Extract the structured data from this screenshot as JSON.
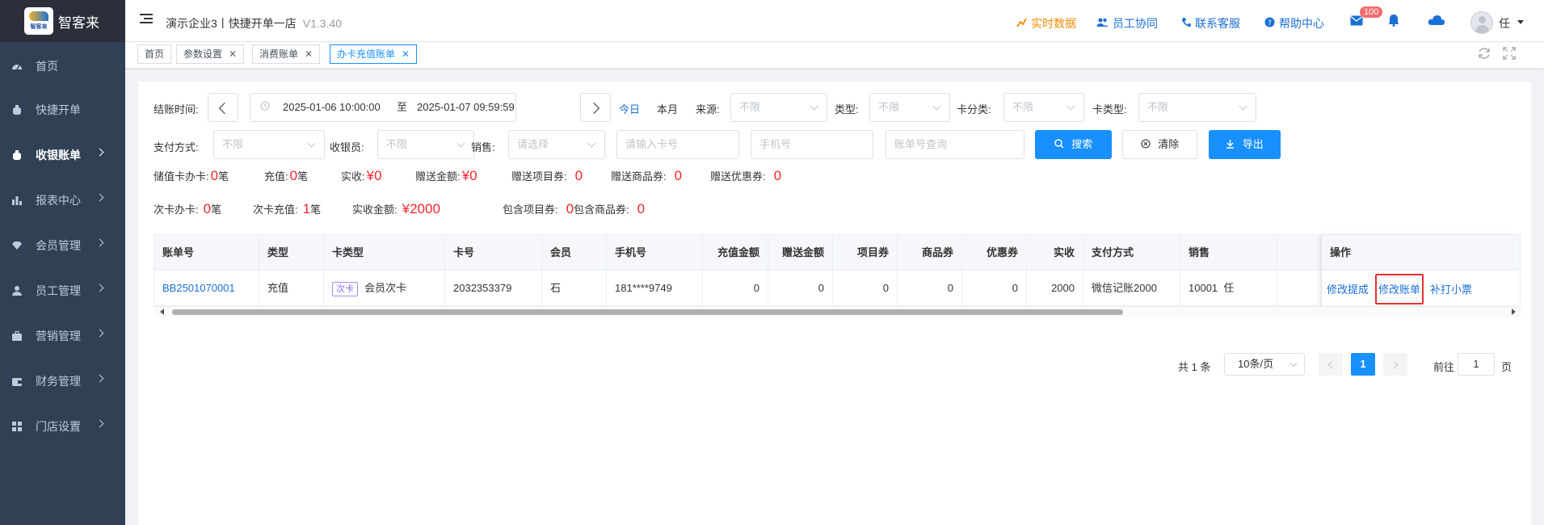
{
  "app": {
    "name": "智客来",
    "logo_text": "智客来"
  },
  "sidebar": {
    "items": [
      {
        "label": "首页",
        "icon": "dashboard-icon"
      },
      {
        "label": "快捷开单",
        "icon": "bag-icon"
      },
      {
        "label": "收银账单",
        "icon": "money-bag-icon",
        "active": true
      },
      {
        "label": "报表中心",
        "icon": "bar-chart-icon"
      },
      {
        "label": "会员管理",
        "icon": "diamond-icon"
      },
      {
        "label": "员工管理",
        "icon": "person-icon"
      },
      {
        "label": "营销管理",
        "icon": "briefcase-icon"
      },
      {
        "label": "财务管理",
        "icon": "wallet-icon"
      },
      {
        "label": "门店设置",
        "icon": "grid-icon"
      }
    ]
  },
  "header": {
    "store": "演示企业3丨快捷开单一店",
    "version": "V1.3.40",
    "links": {
      "realtime": "实时数据",
      "staff": "员工协同",
      "support": "联系客服",
      "help": "帮助中心"
    },
    "mail_badge": "100",
    "user": "任"
  },
  "tags": [
    {
      "label": "首页",
      "closable": false
    },
    {
      "label": "参数设置",
      "closable": true
    },
    {
      "label": "消费账单",
      "closable": true
    },
    {
      "label": "办卡充值账单",
      "closable": true,
      "active": true
    }
  ],
  "filters": {
    "settle_time_label": "结账时间:",
    "date_start": "2025-01-06 10:00:00",
    "date_sep": "至",
    "date_end": "2025-01-07 09:59:59",
    "today": "今日",
    "this_month": "本月",
    "source_label": "来源:",
    "source_value": "不限",
    "type_label": "类型:",
    "type_value": "不限",
    "card_cat_label": "卡分类:",
    "card_cat_value": "不限",
    "card_type_label": "卡类型:",
    "card_type_value": "不限",
    "pay_label": "支付方式:",
    "pay_value": "不限",
    "cashier_label": "收银员:",
    "cashier_value": "不限",
    "sales_label": "销售:",
    "sales_placeholder": "请选择",
    "card_no_placeholder": "请输入卡号",
    "phone_placeholder": "手机号",
    "bill_no_placeholder": "账单号查询",
    "search": "搜索",
    "clear": "清除",
    "export": "导出"
  },
  "stats": {
    "row1": [
      {
        "label": "储值卡办卡:",
        "value": "0",
        "unit": "笔"
      },
      {
        "label": "充值:",
        "value": "0",
        "unit": "笔"
      },
      {
        "label": "实收:",
        "value": "¥0",
        "unit": ""
      },
      {
        "label": "赠送金额:",
        "value": "¥0",
        "unit": ""
      },
      {
        "label": "赠送项目券:",
        "value": "0",
        "unit": ""
      },
      {
        "label": "赠送商品券:",
        "value": "0",
        "unit": ""
      },
      {
        "label": "赠送优惠券:",
        "value": "0",
        "unit": ""
      }
    ],
    "row2": [
      {
        "label": "次卡办卡:",
        "value": "0",
        "unit": "笔"
      },
      {
        "label": "次卡充值:",
        "value": "1",
        "unit": "笔"
      },
      {
        "label": "实收金额:",
        "value": "¥2000",
        "unit": ""
      },
      {
        "label": "包含项目券:",
        "value": "0",
        "unit": ""
      },
      {
        "label": "包含商品券:",
        "value": "0",
        "unit": ""
      }
    ]
  },
  "table": {
    "headers": [
      "账单号",
      "类型",
      "卡类型",
      "卡号",
      "会员",
      "手机号",
      "充值金额",
      "赠送金额",
      "项目券",
      "商品券",
      "优惠券",
      "实收",
      "支付方式",
      "销售",
      "",
      "操作"
    ],
    "rows": [
      {
        "bill_no": "BB2501070001",
        "type": "充值",
        "card_tag": "次卡",
        "card_type": "会员次卡",
        "card_no": "2032353379",
        "member": "石",
        "phone": "181****9749",
        "recharge": "0",
        "gift": "0",
        "item_coupon": "0",
        "goods_coupon": "0",
        "coupon": "0",
        "received": "2000",
        "payment": "微信记账2000",
        "sales": "10001  任",
        "ops": [
          "修改提成",
          "修改账单",
          "补打小票"
        ]
      }
    ]
  },
  "pagination": {
    "total": "共 1 条",
    "page_size": "10条/页",
    "current": "1",
    "goto_label": "前往",
    "goto_value": "1",
    "page_unit": "页"
  }
}
